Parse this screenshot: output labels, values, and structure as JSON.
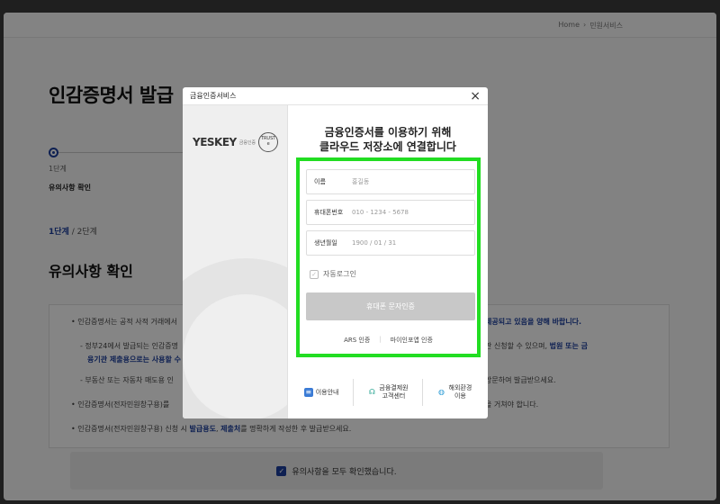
{
  "breadcrumb": {
    "home": "Home",
    "sep": "›",
    "current": "민원서비스"
  },
  "page": {
    "title": "인감증명서 발급",
    "step_num": "1단계",
    "step_name": "유의사항 확인",
    "step_current": "1단계",
    "step_total": "/ 2단계",
    "section_title": "유의사항 확인",
    "notices": [
      "• 인감증명서는 공적 사적 거래에서",
      "제공되고 있음을 양해 바랍니다.",
      "- 정부24에서 발급되는 인감증명",
      "판 신청할 수 있으며,",
      "법원 또는 금",
      "융기관 제출용으로는 사용할 수",
      "- 부동산 또는 자동차 매도용 인",
      "방문하여 발급받으세요.",
      "• 인감증명서(전자민원창구용)를",
      "을 거쳐야 합니다.",
      "• 인감증명서(전자민원창구용) 신청 시",
      "발급용도",
      "제출처",
      "를 명확하게 작성한 후 발급받으세요."
    ],
    "agree_label": "유의사항을 모두 확인했습니다."
  },
  "modal": {
    "title": "금융인증서비스",
    "close": "×",
    "logo": "YESKEY",
    "logo_sub": "금융인증",
    "trust": "TRUST",
    "heading_line1": "금융인증서를 이용하기 위해",
    "heading_line2": "클라우드 저장소에 연결합니다",
    "fields": {
      "name_label": "이름",
      "name_placeholder": "홍길동",
      "phone_label": "휴대폰번호",
      "phone_placeholder": "010 - 1234 - 5678",
      "birth_label": "생년월일",
      "birth_placeholder": "1900 / 01 / 31"
    },
    "auto_login": "자동로그인",
    "sms_button": "휴대폰 문자인증",
    "ars": "ARS 인증",
    "mydata": "마이인포앱 인증",
    "footer": {
      "guide": "이용안내",
      "center_line1": "금융결제원",
      "center_line2": "고객센터",
      "abroad_line1": "해외환경",
      "abroad_line2": "이용"
    }
  },
  "colors": {
    "highlight": "#22dd22",
    "accent": "#1c3f9e"
  }
}
